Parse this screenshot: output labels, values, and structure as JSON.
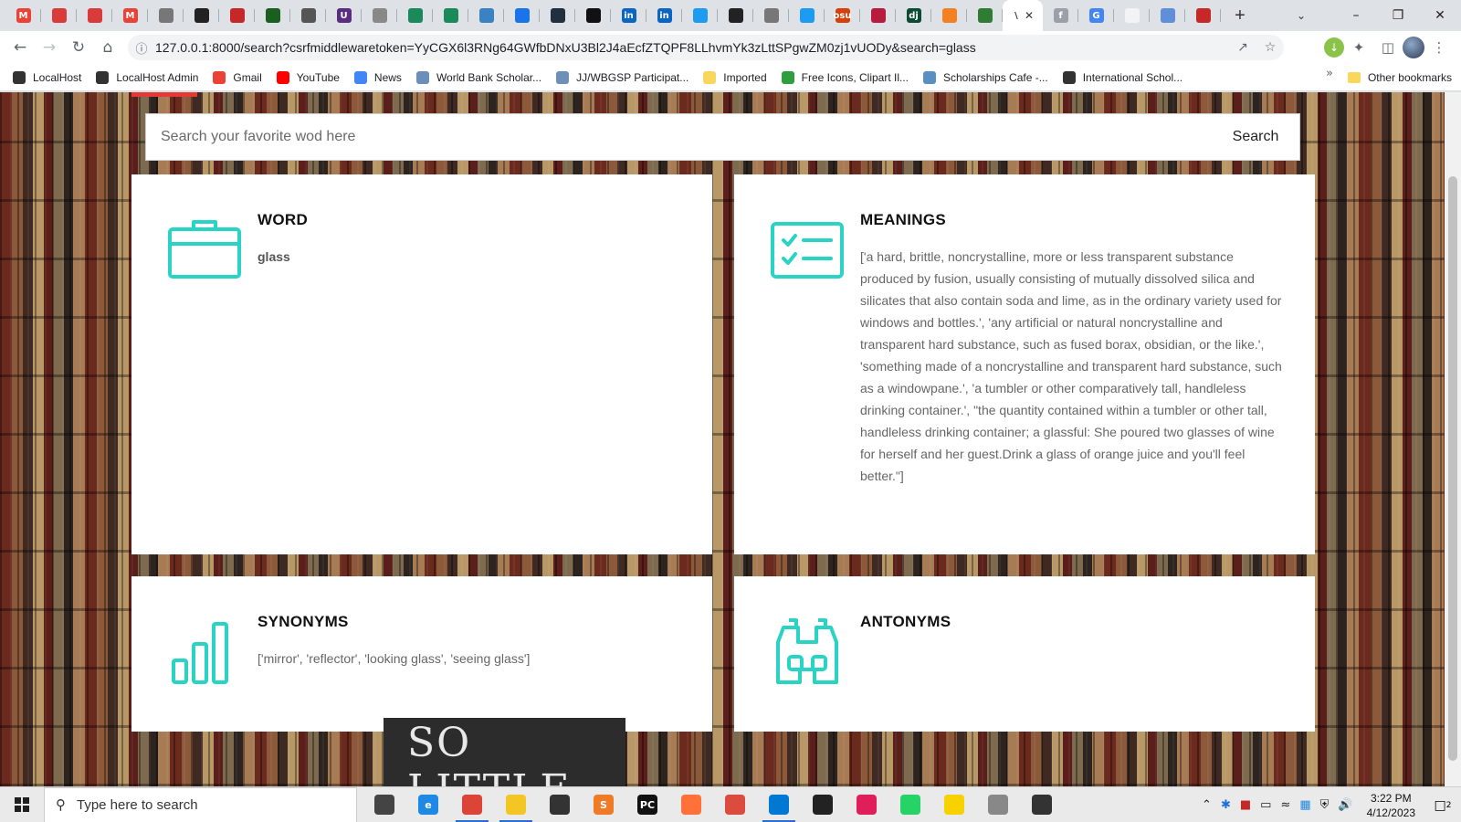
{
  "browser": {
    "tabs": [
      {
        "icon": "gmail-icon",
        "glyph": "M",
        "color": "#ea4335"
      },
      {
        "icon": "opera-red-icon",
        "glyph": "",
        "color": "#d93a3a"
      },
      {
        "icon": "opera-red-icon",
        "glyph": "",
        "color": "#d93a3a"
      },
      {
        "icon": "gmail-icon",
        "glyph": "M",
        "color": "#ea4335"
      },
      {
        "icon": "document-icon",
        "glyph": "",
        "color": "#777777"
      },
      {
        "icon": "github-icon",
        "glyph": "",
        "color": "#222222"
      },
      {
        "icon": "barcode-icon",
        "glyph": "",
        "color": "#c62828"
      },
      {
        "icon": "green-square-icon",
        "glyph": "",
        "color": "#1b5e20"
      },
      {
        "icon": "globe-icon",
        "glyph": "",
        "color": "#555555"
      },
      {
        "icon": "udemy-icon",
        "glyph": "U",
        "color": "#5a2d82"
      },
      {
        "icon": "globe-icon",
        "glyph": "",
        "color": "#888888"
      },
      {
        "icon": "cloud-icon",
        "glyph": "",
        "color": "#1b8a5a"
      },
      {
        "icon": "cloud-icon",
        "glyph": "",
        "color": "#1b8a5a"
      },
      {
        "icon": "globe-icon",
        "glyph": "",
        "color": "#3b82c4"
      },
      {
        "icon": "refresh-icon",
        "glyph": "",
        "color": "#1a73e8"
      },
      {
        "icon": "circle-dark-icon",
        "glyph": "",
        "color": "#203040"
      },
      {
        "icon": "medium-icon",
        "glyph": "",
        "color": "#111111"
      },
      {
        "icon": "linkedin-icon",
        "glyph": "in",
        "color": "#0a66c2"
      },
      {
        "icon": "linkedin-icon",
        "glyph": "in",
        "color": "#0a66c2"
      },
      {
        "icon": "twitter-icon",
        "glyph": "",
        "color": "#1d9bf0"
      },
      {
        "icon": "image-dark-icon",
        "glyph": "",
        "color": "#222222"
      },
      {
        "icon": "shield-icon",
        "glyph": "",
        "color": "#777777"
      },
      {
        "icon": "twitter-icon",
        "glyph": "",
        "color": "#1d9bf0"
      },
      {
        "icon": "osu-icon",
        "glyph": "osu",
        "color": "#d73f09"
      },
      {
        "icon": "bookmark-red-icon",
        "glyph": "",
        "color": "#b71c3c"
      },
      {
        "icon": "django-icon",
        "glyph": "dj",
        "color": "#0c4b33"
      },
      {
        "icon": "stackoverflow-icon",
        "glyph": "",
        "color": "#f48024"
      },
      {
        "icon": "infinity-icon",
        "glyph": "",
        "color": "#2e7d32"
      }
    ],
    "active_tab_glyph": "\\",
    "after_tabs": [
      {
        "icon": "facebook-icon",
        "glyph": "f",
        "color": "#9aa0a6"
      },
      {
        "icon": "google-icon",
        "glyph": "G",
        "color": "#4285f4"
      },
      {
        "icon": "blank-page-icon",
        "glyph": "",
        "color": "#f1f3f4"
      },
      {
        "icon": "inbox-icon",
        "glyph": "",
        "color": "#5f8fd9"
      },
      {
        "icon": "flag-icon",
        "glyph": "",
        "color": "#c62828"
      }
    ],
    "url": "127.0.0.1:8000/search?csrfmiddlewaretoken=YyCGX6l3RNg64GWfbDNxU3Bl2J4aEcfZTQPF8LLhvmYk3zLttSPgwZM0zj1vUODy&search=glass",
    "bookmarks": [
      {
        "label": "LocalHost",
        "icon": "localhost-icon",
        "color": "#333333"
      },
      {
        "label": "LocalHost Admin",
        "icon": "localhost-icon",
        "color": "#333333"
      },
      {
        "label": "Gmail",
        "icon": "gmail-icon",
        "color": "#ea4335"
      },
      {
        "label": "YouTube",
        "icon": "youtube-icon",
        "color": "#ff0000"
      },
      {
        "label": "News",
        "icon": "news-icon",
        "color": "#4285f4"
      },
      {
        "label": "World Bank Scholar...",
        "icon": "globe-icon",
        "color": "#6b8fb8"
      },
      {
        "label": "JJ/WBGSP Participat...",
        "icon": "globe-icon",
        "color": "#6b8fb8"
      },
      {
        "label": "Imported",
        "icon": "folder-icon",
        "color": "#f9d65c"
      },
      {
        "label": "Free Icons, Clipart Il...",
        "icon": "icons-site-icon",
        "color": "#2e9e3e"
      },
      {
        "label": "Scholarships Cafe -...",
        "icon": "cafe-icon",
        "color": "#5a8fc2"
      },
      {
        "label": "International Schol...",
        "icon": "scholar-icon",
        "color": "#333333"
      }
    ],
    "other_bookmarks": "Other bookmarks"
  },
  "page": {
    "search": {
      "placeholder": "Search your favorite wod here",
      "button": "Search"
    },
    "cards": {
      "word": {
        "title": "WORD",
        "text": "glass"
      },
      "meanings": {
        "title": "MEANINGS",
        "text": "['a hard, brittle, noncrystalline, more or less transparent substance produced by fusion, usually consisting of mutually dissolved silica and silicates that also contain soda and lime, as in the ordinary variety used for windows and bottles.', 'any artificial or natural noncrystalline and transparent hard substance, such as fused borax, obsidian, or the like.', 'something made of a noncrystalline and transparent hard substance, such as a windowpane.', 'a tumbler or other comparatively tall, handleless drinking container.', \"the quantity contained within a tumbler or other tall, handleless drinking container; a glassful: She poured two glasses of wine for herself and her guest.Drink a glass of orange juice and you'll feel better.\"]"
      },
      "synonyms": {
        "title": "SYNONYMS",
        "text": "['mirror', 'reflector', 'looking glass', 'seeing glass']"
      },
      "antonyms": {
        "title": "ANTONYMS",
        "text": ""
      }
    },
    "accent_color": "#2ad4c4",
    "background_sign": "SO LITTLE"
  },
  "taskbar": {
    "search_placeholder": "Type here to search",
    "apps": [
      {
        "icon": "task-view-icon",
        "glyph": "",
        "color": "#444444",
        "open": false
      },
      {
        "icon": "edge-icon",
        "glyph": "e",
        "color": "#1e88e5",
        "open": false
      },
      {
        "icon": "chrome-icon",
        "glyph": "",
        "color": "#db4437",
        "open": true
      },
      {
        "icon": "file-explorer-icon",
        "glyph": "",
        "color": "#f3c623",
        "open": true
      },
      {
        "icon": "store-icon",
        "glyph": "",
        "color": "#333333",
        "open": false
      },
      {
        "icon": "sublime-icon",
        "glyph": "S",
        "color": "#f07b27",
        "open": false
      },
      {
        "icon": "pycharm-icon",
        "glyph": "PC",
        "color": "#111111",
        "open": false
      },
      {
        "icon": "firefox-icon",
        "glyph": "",
        "color": "#ff7139",
        "open": false
      },
      {
        "icon": "todoist-icon",
        "glyph": "",
        "color": "#db4c3f",
        "open": false
      },
      {
        "icon": "vscode-icon",
        "glyph": "",
        "color": "#0078d4",
        "open": true
      },
      {
        "icon": "mail-icon",
        "glyph": "",
        "color": "#222222",
        "open": false
      },
      {
        "icon": "slack-icon",
        "glyph": "",
        "color": "#e01e5a",
        "open": false
      },
      {
        "icon": "whatsapp-icon",
        "glyph": "",
        "color": "#25d366",
        "open": false
      },
      {
        "icon": "sticky-notes-icon",
        "glyph": "",
        "color": "#f7d100",
        "open": false
      },
      {
        "icon": "photos-icon",
        "glyph": "",
        "color": "#888888",
        "open": false
      },
      {
        "icon": "obs-icon",
        "glyph": "",
        "color": "#333333",
        "open": false
      }
    ],
    "time": "3:22 PM",
    "date": "4/12/2023",
    "notifications": "2"
  }
}
